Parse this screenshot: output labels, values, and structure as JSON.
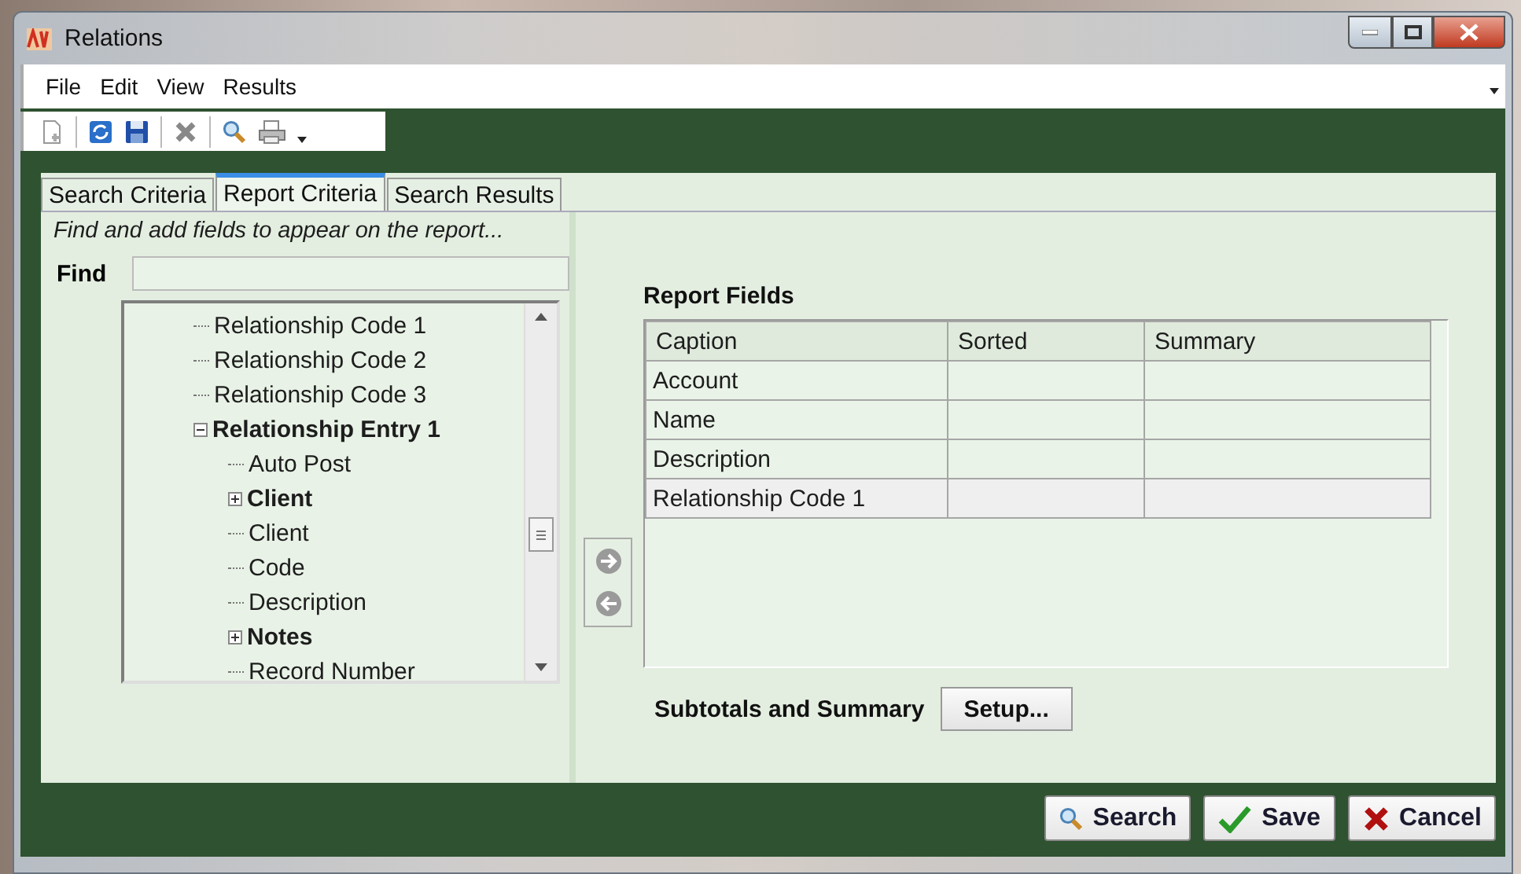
{
  "window": {
    "title": "Relations"
  },
  "menu": [
    {
      "label": "File"
    },
    {
      "label": "Edit"
    },
    {
      "label": "View"
    },
    {
      "label": "Results"
    }
  ],
  "toolbar": [
    {
      "kind": "new"
    },
    {
      "kind": "refresh"
    },
    {
      "kind": "save"
    },
    {
      "kind": "delete"
    },
    {
      "kind": "search"
    },
    {
      "kind": "print"
    }
  ],
  "tabs": [
    {
      "label": "Search Criteria",
      "selected": false
    },
    {
      "label": "Report Criteria",
      "selected": true
    },
    {
      "label": "Search Results",
      "selected": false
    }
  ],
  "hint": "Find and add fields to appear on the report...",
  "find": {
    "label": "Find"
  },
  "tree": [
    {
      "label": "Relationship Code 1",
      "kind": "field"
    },
    {
      "label": "Relationship Code 2",
      "kind": "field"
    },
    {
      "label": "Relationship Code 3",
      "kind": "field"
    },
    {
      "label": "Relationship Entry 1",
      "kind": "group",
      "expanded": true,
      "children": [
        {
          "label": "Auto Post",
          "kind": "field"
        },
        {
          "label": "Client",
          "kind": "group",
          "expanded": false
        },
        {
          "label": "Client",
          "kind": "field"
        },
        {
          "label": "Code",
          "kind": "field"
        },
        {
          "label": "Description",
          "kind": "field"
        },
        {
          "label": "Notes",
          "kind": "group",
          "expanded": false
        },
        {
          "label": "Record Number",
          "kind": "field"
        }
      ]
    }
  ],
  "report_fields": {
    "title": "Report Fields",
    "columns": [
      "Caption",
      "Sorted",
      "Summary"
    ],
    "rows": [
      [
        "Account",
        "",
        ""
      ],
      [
        "Name",
        "",
        ""
      ],
      [
        "Description",
        "",
        ""
      ],
      [
        "Relationship Code 1",
        "",
        ""
      ]
    ]
  },
  "subtotals": {
    "label": "Subtotals and Summary",
    "button": "Setup..."
  },
  "buttons": [
    {
      "label": "Search",
      "kind": "search"
    },
    {
      "label": "Save",
      "kind": "save"
    },
    {
      "label": "Cancel",
      "kind": "cancel"
    }
  ]
}
